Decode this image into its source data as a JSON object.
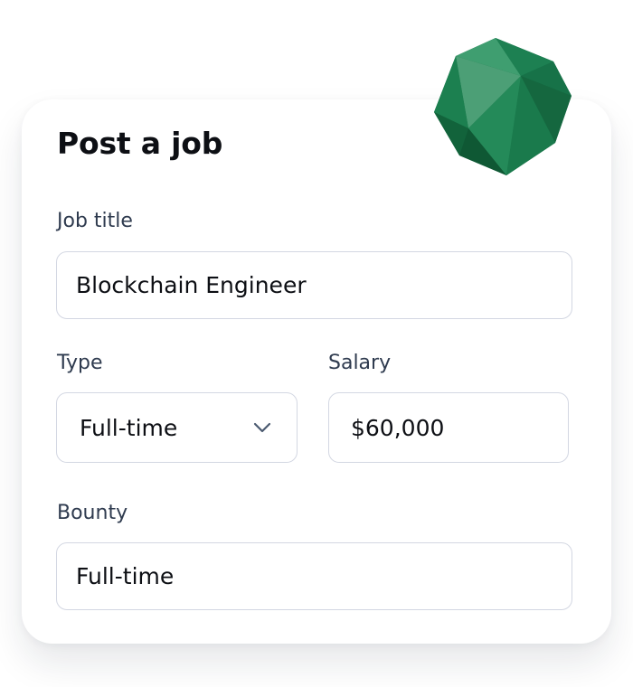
{
  "form": {
    "title": "Post a job",
    "job_title": {
      "label": "Job title",
      "value": "Blockchain Engineer"
    },
    "type": {
      "label": "Type",
      "selected": "Full-time"
    },
    "salary": {
      "label": "Salary",
      "value": "$60,000"
    },
    "bounty": {
      "label": "Bounty",
      "value": "Full-time"
    }
  },
  "colors": {
    "gem": "#1a7a4c",
    "text": "#0d0f14",
    "label": "#2f3b4f",
    "border": "#d3d7e2"
  },
  "icons": {
    "decoration": "icosahedron-gem-icon",
    "select": "chevron-down-icon"
  }
}
